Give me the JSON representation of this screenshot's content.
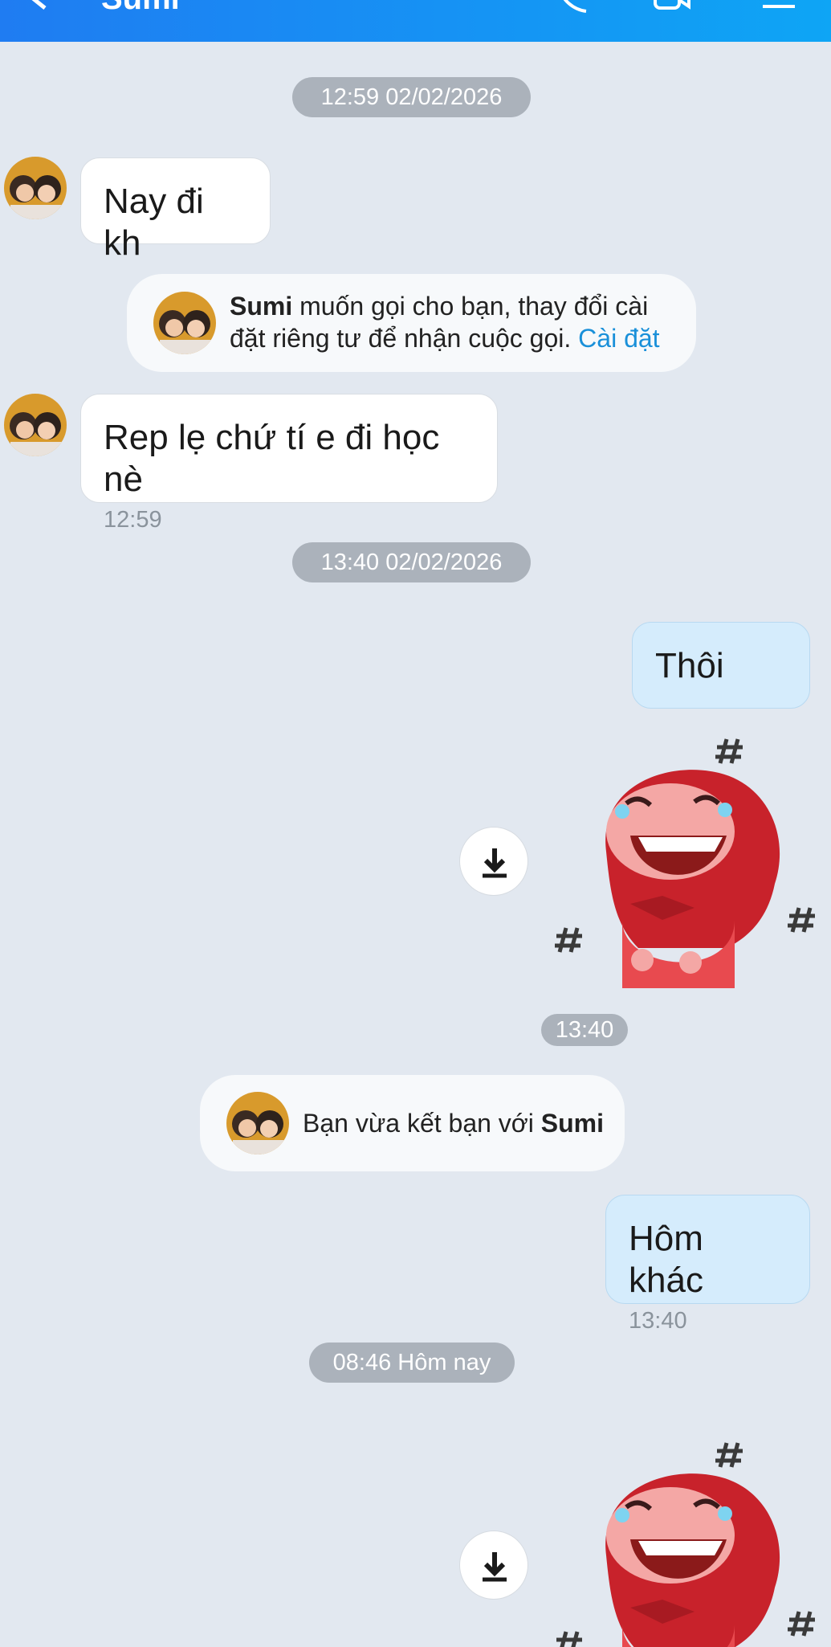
{
  "header": {
    "title": "Sumi"
  },
  "chat": {
    "date_sep_1": "12:59 02/02/2026",
    "msg_1": {
      "text": "Nay đi kh"
    },
    "call_notice": {
      "name": "Sumi",
      "text": " muốn gọi cho bạn, thay đổi cài",
      "text2": "đặt riêng tư để nhận cuộc gọi. ",
      "link": "Cài đặt"
    },
    "msg_2": {
      "text": "Rep lẹ chứ tí e đi học nè",
      "time": "12:59"
    },
    "date_sep_2": "13:40 02/02/2026",
    "msg_3": {
      "text": "Thôi"
    },
    "sticker_time": "13:40",
    "friend_notice": {
      "text": "Bạn vừa kết bạn với ",
      "name": "Sumi"
    },
    "msg_4": {
      "text": "Hôm khác",
      "time": "13:40"
    },
    "date_sep_3": "08:46 Hôm nay"
  },
  "icons": {
    "back": "back-arrow-icon",
    "call": "phone-icon",
    "video": "video-call-icon",
    "menu": "menu-icon",
    "download": "download-icon"
  },
  "colors": {
    "header_start": "#1f7cf2",
    "header_end": "#0ea5f5",
    "background": "#e2e8f0",
    "outgoing_bubble": "#d5ecfc",
    "incoming_bubble": "#ffffff",
    "link": "#1a90d9",
    "pill": "#abb2bb"
  }
}
